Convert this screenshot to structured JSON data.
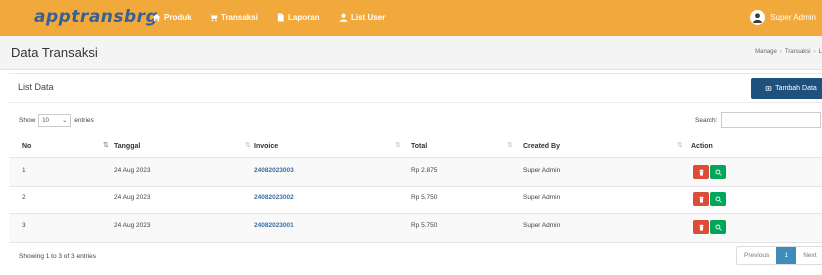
{
  "navbar": {
    "brand": "apptransbrg",
    "menu": [
      {
        "label": "Produk",
        "icon": "home-icon"
      },
      {
        "label": "Transaksi",
        "icon": "cart-icon"
      },
      {
        "label": "Laporan",
        "icon": "file-icon"
      },
      {
        "label": "List User",
        "icon": "user-icon"
      }
    ],
    "user": "Super Admin"
  },
  "header": {
    "title": "Data Transaksi",
    "breadcrumb": [
      "Manage",
      "Transaksi",
      "L"
    ]
  },
  "box": {
    "title": "List Data",
    "add_button": "Tambah Data"
  },
  "controls": {
    "show_label": "Show",
    "page_size": "10",
    "entries_label": "entries",
    "search_label": "Search:"
  },
  "table": {
    "columns": [
      "No",
      "Tanggal",
      "Invoice",
      "Total",
      "Created By",
      "Action"
    ],
    "rows": [
      {
        "no": "1",
        "tanggal": "24 Aug 2023",
        "invoice": "24082023003",
        "total": "Rp 2.875",
        "created_by": "Super Admin"
      },
      {
        "no": "2",
        "tanggal": "24 Aug 2023",
        "invoice": "24082023002",
        "total": "Rp 5.750",
        "created_by": "Super Admin"
      },
      {
        "no": "3",
        "tanggal": "24 Aug 2023",
        "invoice": "24082023001",
        "total": "Rp 5.750",
        "created_by": "Super Admin"
      }
    ]
  },
  "footer": {
    "info": "Showing 1 to 3 of 3 entries",
    "previous": "Previous",
    "current_page": "1",
    "next": "Next"
  },
  "colors": {
    "navbar": "#f2a93b",
    "brand": "#3a5f96",
    "primary_button": "#20507e",
    "delete": "#dd4b39",
    "view": "#00a65a",
    "link": "#3a6ea5"
  }
}
